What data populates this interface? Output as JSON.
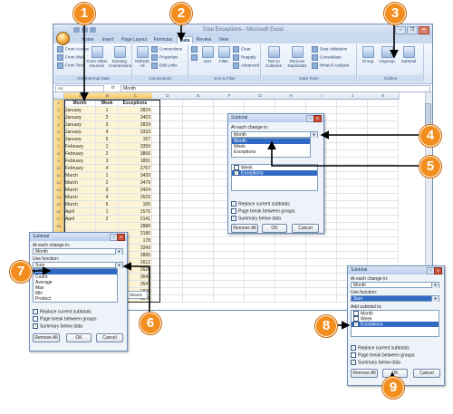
{
  "window": {
    "title": "Total Exceptions - Microsoft Excel",
    "controls": [
      "–",
      "❐",
      "✕"
    ]
  },
  "tabs": [
    "Home",
    "Insert",
    "Page Layout",
    "Formulas",
    "Data",
    "Review",
    "View"
  ],
  "active_tab": "Data",
  "ribbon": {
    "get_external": {
      "items": [
        "From Access",
        "From Web",
        "From Text"
      ],
      "other": "From Other Sources",
      "existing": "Existing Connections",
      "label": "Get External Data"
    },
    "connections": {
      "refresh": "Refresh All",
      "items": [
        "Connections",
        "Properties",
        "Edit Links"
      ],
      "label": "Connections"
    },
    "sort_filter": {
      "sort": "Sort",
      "filter": "Filter",
      "items": [
        "Clear",
        "Reapply",
        "Advanced"
      ],
      "label": "Sort & Filter"
    },
    "data_tools": {
      "text_to_columns": "Text to Columns",
      "remove_dup": "Remove Duplicates",
      "items": [
        "Data Validation",
        "Consolidate",
        "What-If Analysis"
      ],
      "label": "Data Tools"
    },
    "outline": {
      "group": "Group",
      "ungroup": "Ungroup",
      "subtotal": "Subtotal",
      "label": "Outline"
    }
  },
  "formula_bar": {
    "name_box": "A1",
    "fx": "fx",
    "value": "Month"
  },
  "columns": [
    "A",
    "B",
    "C",
    "D",
    "E",
    "F",
    "G",
    "H",
    "I",
    "J",
    "K"
  ],
  "table": {
    "headers": [
      "Month",
      "Week",
      "Exceptions"
    ],
    "rows": [
      [
        "January",
        "1",
        "2824"
      ],
      [
        "January",
        "2",
        "3403"
      ],
      [
        "January",
        "3",
        "2829"
      ],
      [
        "January",
        "4",
        "3333"
      ],
      [
        "January",
        "5",
        "157"
      ],
      [
        "February",
        "1",
        "3359"
      ],
      [
        "February",
        "2",
        "3866"
      ],
      [
        "February",
        "3",
        "1891"
      ],
      [
        "February",
        "4",
        "2767"
      ],
      [
        "March",
        "1",
        "3429"
      ],
      [
        "March",
        "2",
        "3479"
      ],
      [
        "March",
        "3",
        "2424"
      ],
      [
        "March",
        "4",
        "2629"
      ],
      [
        "March",
        "5",
        "106"
      ],
      [
        "April",
        "1",
        "1576"
      ],
      [
        "April",
        "2",
        "2141"
      ],
      [
        "",
        "",
        "2888"
      ],
      [
        "",
        "",
        "2180"
      ],
      [
        "",
        "",
        "178"
      ],
      [
        "",
        "",
        "3349"
      ],
      [
        "",
        "",
        "2895"
      ],
      [
        "",
        "",
        "2612"
      ],
      [
        "",
        "",
        "2626"
      ],
      [
        "",
        "",
        "3643"
      ],
      [
        "",
        "",
        "3547"
      ],
      [
        "",
        "",
        "1826"
      ],
      [
        "",
        "",
        "1870"
      ]
    ]
  },
  "sheet_tab": "Sheet1",
  "dialog_center": {
    "title": "Subtotal",
    "at_each_change_label": "At each change in:",
    "at_each_change_value": "Month",
    "dropdown_items": [
      "Month",
      "Week",
      "Exceptions"
    ],
    "subtotal_items": [
      "Week",
      "Exceptions"
    ],
    "options": [
      "Replace current subtotals",
      "Page break between groups",
      "Summary below data"
    ],
    "buttons": [
      "Remove All",
      "OK",
      "Cancel"
    ]
  },
  "dialog_left": {
    "title": "Subtotal",
    "at_each_change_label": "At each change in:",
    "at_each_change_value": "Month",
    "use_function_label": "Use function:",
    "use_function_value": "Sum",
    "function_items": [
      "Sum",
      "Count",
      "Average",
      "Max",
      "Min",
      "Product"
    ],
    "options": [
      "Replace current subtotals",
      "Page break between groups",
      "Summary below data"
    ],
    "buttons": [
      "Remove All",
      "OK",
      "Cancel"
    ]
  },
  "dialog_right": {
    "title": "Subtotal",
    "at_each_change_label": "At each change in:",
    "at_each_change_value": "Month",
    "use_function_label": "Use function:",
    "use_function_value": "Sum",
    "add_subtotal_label": "Add subtotal to:",
    "add_subtotal_items": [
      "Month",
      "Week",
      "Exceptions"
    ],
    "options": [
      "Replace current subtotals",
      "Page break between groups",
      "Summary below data"
    ],
    "buttons": [
      "Remove All",
      "OK",
      "Cancel"
    ]
  },
  "callouts": [
    "1",
    "2",
    "3",
    "4",
    "5",
    "6",
    "7",
    "8",
    "9"
  ],
  "colors": {
    "callout": "#f28d1e",
    "selection": "#316ac5",
    "accent": "#6f8fb8"
  }
}
